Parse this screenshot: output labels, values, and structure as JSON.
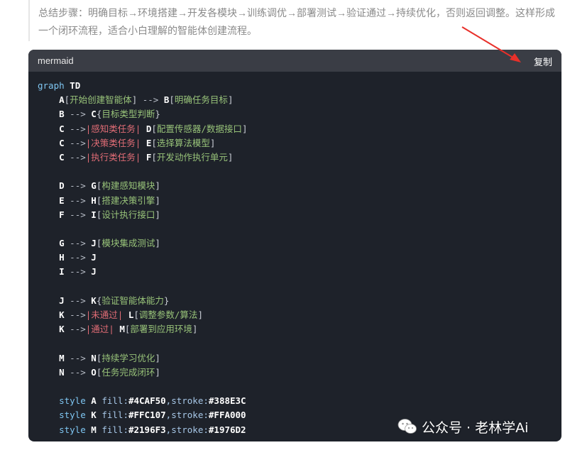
{
  "summary_text": "总结步骤：明确目标→环境搭建→开发各模块→训练调优→部署测试→验证通过→持续优化，否则返回调整。这样形成一个闭环流程，适合小白理解的智能体创建流程。",
  "code_block": {
    "language": "mermaid",
    "copy_label": "复制",
    "lines": [
      {
        "type": "header",
        "kw": "graph",
        "dir": "TD"
      },
      {
        "type": "edge",
        "from": "A",
        "from_open": "[",
        "from_label": "开始创建智能体",
        "from_close": "]",
        "arrow": " --> ",
        "cond": "",
        "to": "B",
        "to_open": "[",
        "to_label": "明确任务目标",
        "to_close": "]"
      },
      {
        "type": "edge",
        "from": "B",
        "arrow": " --> ",
        "cond": "",
        "to": "C",
        "to_open": "{",
        "to_label": "目标类型判断",
        "to_close": "}"
      },
      {
        "type": "edge",
        "from": "C",
        "arrow": " -->",
        "cond": "|感知类任务|",
        "to": "D",
        "to_open": "[",
        "to_label": "配置传感器/数据接口",
        "to_close": "]"
      },
      {
        "type": "edge",
        "from": "C",
        "arrow": " -->",
        "cond": "|决策类任务|",
        "to": "E",
        "to_open": "[",
        "to_label": "选择算法模型",
        "to_close": "]"
      },
      {
        "type": "edge",
        "from": "C",
        "arrow": " -->",
        "cond": "|执行类任务|",
        "to": "F",
        "to_open": "[",
        "to_label": "开发动作执行单元",
        "to_close": "]"
      },
      {
        "type": "blank"
      },
      {
        "type": "edge",
        "from": "D",
        "arrow": " --> ",
        "cond": "",
        "to": "G",
        "to_open": "[",
        "to_label": "构建感知模块",
        "to_close": "]"
      },
      {
        "type": "edge",
        "from": "E",
        "arrow": " --> ",
        "cond": "",
        "to": "H",
        "to_open": "[",
        "to_label": "搭建决策引擎",
        "to_close": "]"
      },
      {
        "type": "edge",
        "from": "F",
        "arrow": " --> ",
        "cond": "",
        "to": "I",
        "to_open": "[",
        "to_label": "设计执行接口",
        "to_close": "]"
      },
      {
        "type": "blank"
      },
      {
        "type": "edge",
        "from": "G",
        "arrow": " --> ",
        "cond": "",
        "to": "J",
        "to_open": "[",
        "to_label": "模块集成测试",
        "to_close": "]"
      },
      {
        "type": "edge",
        "from": "H",
        "arrow": " --> ",
        "cond": "",
        "to": "J"
      },
      {
        "type": "edge",
        "from": "I",
        "arrow": " --> ",
        "cond": "",
        "to": "J"
      },
      {
        "type": "blank"
      },
      {
        "type": "edge",
        "from": "J",
        "arrow": " --> ",
        "cond": "",
        "to": "K",
        "to_open": "{",
        "to_label": "验证智能体能力",
        "to_close": "}"
      },
      {
        "type": "edge",
        "from": "K",
        "arrow": " -->",
        "cond": "|未通过|",
        "to": "L",
        "to_open": "[",
        "to_label": "调整参数/算法",
        "to_close": "]"
      },
      {
        "type": "edge",
        "from": "K",
        "arrow": " -->",
        "cond": "|通过|",
        "to": "M",
        "to_open": "[",
        "to_label": "部署到应用环境",
        "to_close": "]"
      },
      {
        "type": "blank"
      },
      {
        "type": "edge",
        "from": "M",
        "arrow": " --> ",
        "cond": "",
        "to": "N",
        "to_open": "[",
        "to_label": "持续学习优化",
        "to_close": "]"
      },
      {
        "type": "edge",
        "from": "N",
        "arrow": " --> ",
        "cond": "",
        "to": "O",
        "to_open": "[",
        "to_label": "任务完成闭环",
        "to_close": "]"
      },
      {
        "type": "blank"
      },
      {
        "type": "style",
        "kw": "style",
        "node": "A",
        "fill": "#4CAF50",
        "stroke": "#388E3C"
      },
      {
        "type": "style",
        "kw": "style",
        "node": "K",
        "fill": "#FFC107",
        "stroke": "#FFA000"
      },
      {
        "type": "style",
        "kw": "style",
        "node": "M",
        "fill": "#2196F3",
        "stroke": "#1976D2"
      }
    ]
  },
  "watermark": {
    "icon": "wechat-icon",
    "text": "公众号 · 老林学Ai"
  },
  "colors": {
    "code_bg": "#1e222a",
    "header_bg": "#3a3d45",
    "annotation_arrow": "#e8302a"
  }
}
